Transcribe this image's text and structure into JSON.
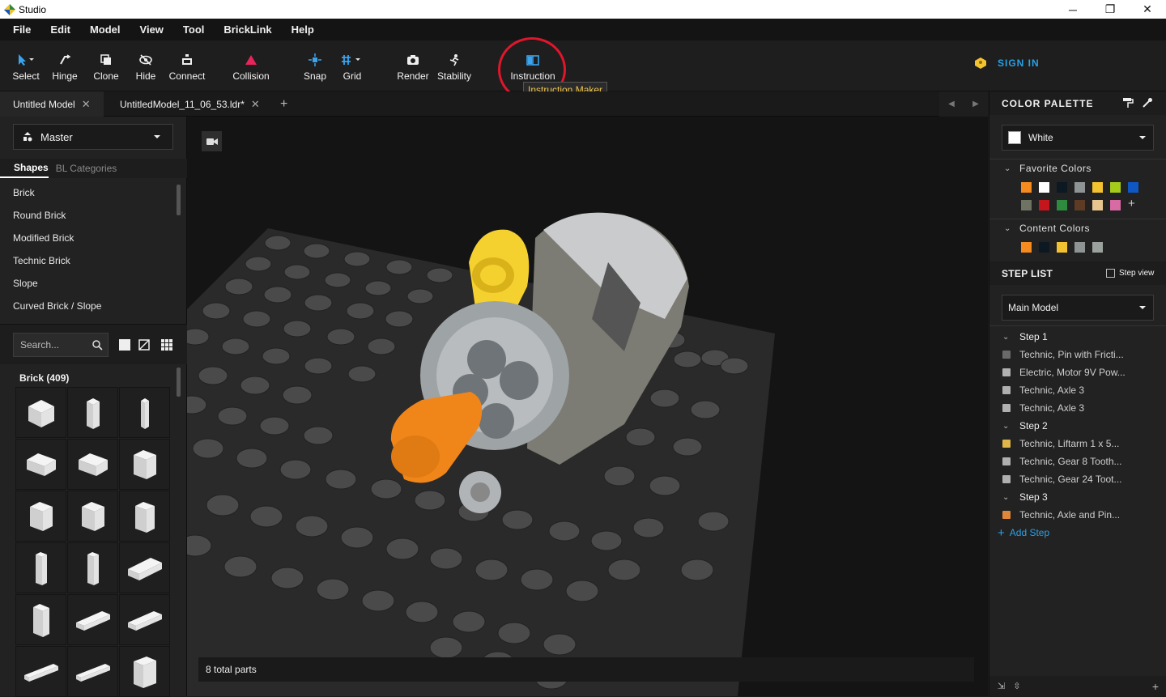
{
  "window": {
    "title": "Studio",
    "minimize": "─",
    "maximize": "❐",
    "close": "✕"
  },
  "menu": [
    "File",
    "Edit",
    "Model",
    "View",
    "Tool",
    "BrickLink",
    "Help"
  ],
  "toolbar": {
    "tools": [
      {
        "label": "Select",
        "icon": "select-arrow-icon"
      },
      {
        "label": "Hinge",
        "icon": "hinge-icon"
      },
      {
        "label": "Clone",
        "icon": "clone-icon"
      },
      {
        "label": "Hide",
        "icon": "hide-eye-icon"
      },
      {
        "label": "Connect",
        "icon": "connect-icon"
      },
      {
        "label": "Collision",
        "icon": "collision-icon"
      },
      {
        "label": "Snap",
        "icon": "snap-icon"
      },
      {
        "label": "Grid",
        "icon": "grid-icon"
      },
      {
        "label": "Render",
        "icon": "camera-icon"
      },
      {
        "label": "Stability",
        "icon": "stability-icon"
      },
      {
        "label": "Instruction",
        "icon": "instruction-book-icon"
      }
    ],
    "tooltip": "Instruction Maker",
    "sign_in": "SIGN IN"
  },
  "tabs": {
    "items": [
      {
        "label": "Untitled Model",
        "close": "✕"
      },
      {
        "label": "UntitledModel_11_06_53.ldr*",
        "close": "✕"
      }
    ],
    "add": "+"
  },
  "left": {
    "master": "Master",
    "subtabs": [
      "Shapes",
      "BL Categories"
    ],
    "categories": [
      "Brick",
      "Round Brick",
      "Modified Brick",
      "Technic Brick",
      "Slope",
      "Curved Brick / Slope"
    ],
    "search_placeholder": "Search...",
    "brick_header": "Brick (409)"
  },
  "viewport": {
    "parts_count": "8 total parts"
  },
  "right": {
    "color_palette_title": "COLOR PALETTE",
    "selected_color": "White",
    "favorite_colors_title": "Favorite Colors",
    "favorite_colors": [
      "#f58a1f",
      "#ffffff",
      "#0c1822",
      "#8e9494",
      "#f2c230",
      "#a5cc1b",
      "#0f57c2",
      "#6f7363",
      "#c5161d",
      "#2d8a3f",
      "#5e3b25",
      "#e6c58f",
      "#d86aa4"
    ],
    "content_colors_title": "Content Colors",
    "content_colors": [
      "#f58a1f",
      "#0c1822",
      "#f2c230",
      "#8e9494",
      "#9ba19d"
    ],
    "step_list_title": "STEP LIST",
    "step_view": "Step view",
    "model_select": "Main Model",
    "steps": [
      {
        "label": "Step 1",
        "parts": [
          {
            "label": "Technic, Pin with Fricti...",
            "color": "#6a6a6a"
          },
          {
            "label": "Electric, Motor 9V Pow...",
            "color": "#b0b0b0"
          },
          {
            "label": "Technic, Axle 3",
            "color": "#b0b0b0"
          },
          {
            "label": "Technic, Axle 3",
            "color": "#b0b0b0"
          }
        ]
      },
      {
        "label": "Step 2",
        "parts": [
          {
            "label": "Technic, Liftarm 1 x 5...",
            "color": "#e0b64a"
          },
          {
            "label": "Technic, Gear 8 Tooth...",
            "color": "#b0b0b0"
          },
          {
            "label": "Technic, Gear 24 Toot...",
            "color": "#b0b0b0"
          }
        ]
      },
      {
        "label": "Step 3",
        "parts": [
          {
            "label": "Technic, Axle and Pin...",
            "color": "#e0863a"
          }
        ]
      }
    ],
    "add_step": "Add Step"
  }
}
